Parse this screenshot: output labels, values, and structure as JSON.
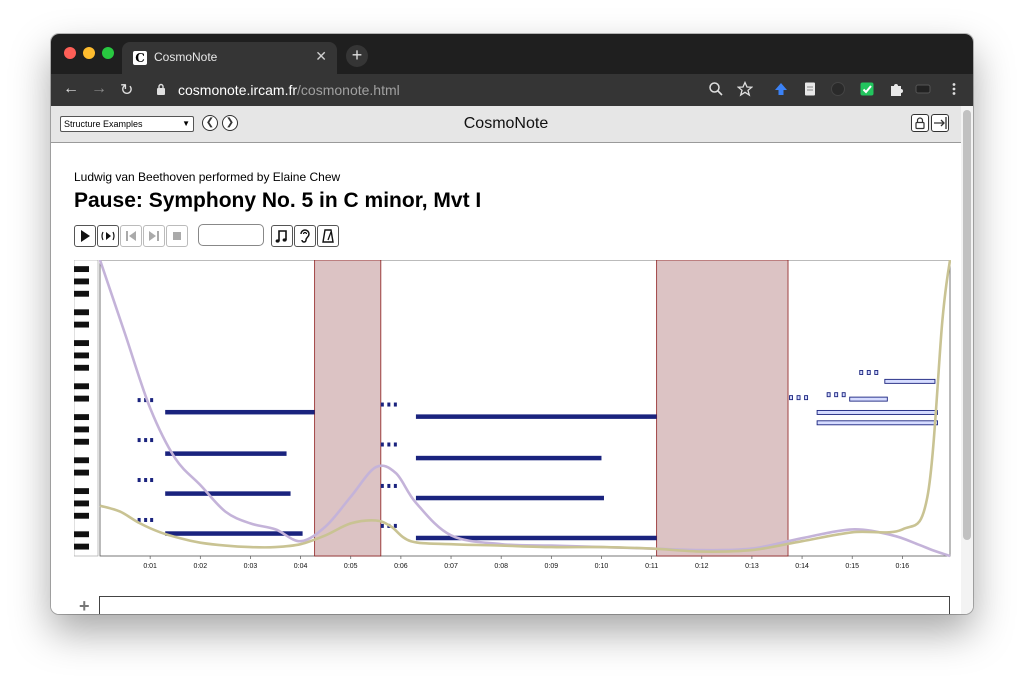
{
  "browser": {
    "tab_title": "CosmoNote",
    "tab_favicon_letter": "C",
    "url_host": "cosmonote.ircam.fr",
    "url_path": "/cosmonote.html"
  },
  "toolbar": {
    "select_value": "Structure Examples",
    "app_title": "CosmoNote"
  },
  "piece": {
    "subtitle": "Ludwig van Beethoven performed by Elaine Chew",
    "title": "Pause: Symphony No. 5 in C minor, Mvt I"
  },
  "colors": {
    "note_fill": "#1a237e",
    "pause_region": "#dcc3c4",
    "pause_border": "#8b1a1a",
    "curve_tempo": "#c4b3d9",
    "curve_loudness": "#c9c393",
    "hollow_note_fill": "#d6dcff"
  },
  "chart_data": {
    "type": "piano-roll",
    "x_unit": "seconds",
    "xlim": [
      0,
      16.95
    ],
    "x_ticks": [
      "0:01",
      "0:02",
      "0:03",
      "0:04",
      "0:05",
      "0:06",
      "0:07",
      "0:08",
      "0:09",
      "0:10",
      "0:11",
      "0:12",
      "0:13",
      "0:14",
      "0:15",
      "0:16"
    ],
    "pitch_range": [
      0,
      100
    ],
    "pauses": [
      {
        "start": 4.28,
        "end": 5.6
      },
      {
        "start": 11.1,
        "end": 13.72
      }
    ],
    "notes": [
      {
        "start": 0.75,
        "end": 0.8,
        "pitch": 52.5
      },
      {
        "start": 0.88,
        "end": 0.93,
        "pitch": 52.5
      },
      {
        "start": 1.0,
        "end": 1.05,
        "pitch": 52.5
      },
      {
        "start": 1.3,
        "end": 4.28,
        "pitch": 48.5,
        "long": true
      },
      {
        "start": 0.75,
        "end": 0.8,
        "pitch": 39
      },
      {
        "start": 0.88,
        "end": 0.93,
        "pitch": 39
      },
      {
        "start": 1.0,
        "end": 1.05,
        "pitch": 39
      },
      {
        "start": 1.3,
        "end": 3.72,
        "pitch": 34.5,
        "long": true
      },
      {
        "start": 0.75,
        "end": 0.8,
        "pitch": 25.5
      },
      {
        "start": 0.88,
        "end": 0.93,
        "pitch": 25.5
      },
      {
        "start": 1.0,
        "end": 1.05,
        "pitch": 25.5
      },
      {
        "start": 1.3,
        "end": 3.8,
        "pitch": 21,
        "long": true
      },
      {
        "start": 0.75,
        "end": 0.8,
        "pitch": 12
      },
      {
        "start": 0.88,
        "end": 0.93,
        "pitch": 12
      },
      {
        "start": 1.0,
        "end": 1.05,
        "pitch": 12
      },
      {
        "start": 1.3,
        "end": 4.04,
        "pitch": 7.5,
        "long": true
      },
      {
        "start": 5.6,
        "end": 5.65,
        "pitch": 51
      },
      {
        "start": 5.73,
        "end": 5.78,
        "pitch": 51
      },
      {
        "start": 5.86,
        "end": 5.91,
        "pitch": 51
      },
      {
        "start": 6.3,
        "end": 11.1,
        "pitch": 47,
        "long": true
      },
      {
        "start": 5.6,
        "end": 5.65,
        "pitch": 37.5
      },
      {
        "start": 5.73,
        "end": 5.78,
        "pitch": 37.5
      },
      {
        "start": 5.86,
        "end": 5.91,
        "pitch": 37.5
      },
      {
        "start": 6.3,
        "end": 10.0,
        "pitch": 33,
        "long": true
      },
      {
        "start": 5.6,
        "end": 5.65,
        "pitch": 23.5
      },
      {
        "start": 5.73,
        "end": 5.78,
        "pitch": 23.5
      },
      {
        "start": 5.86,
        "end": 5.91,
        "pitch": 23.5
      },
      {
        "start": 6.3,
        "end": 10.05,
        "pitch": 19.5,
        "long": true
      },
      {
        "start": 5.6,
        "end": 5.65,
        "pitch": 10
      },
      {
        "start": 5.73,
        "end": 5.78,
        "pitch": 10
      },
      {
        "start": 5.86,
        "end": 5.91,
        "pitch": 10
      },
      {
        "start": 6.3,
        "end": 11.1,
        "pitch": 6,
        "long": true
      },
      {
        "start": 13.75,
        "end": 13.8,
        "pitch": 53.5,
        "hollow": true
      },
      {
        "start": 13.9,
        "end": 13.95,
        "pitch": 53.5,
        "hollow": true
      },
      {
        "start": 14.05,
        "end": 14.1,
        "pitch": 53.5,
        "hollow": true
      },
      {
        "start": 14.5,
        "end": 14.55,
        "pitch": 54.5,
        "hollow": true
      },
      {
        "start": 14.65,
        "end": 14.7,
        "pitch": 54.5,
        "hollow": true
      },
      {
        "start": 14.8,
        "end": 14.85,
        "pitch": 54.5,
        "hollow": true
      },
      {
        "start": 14.95,
        "end": 15.7,
        "pitch": 53,
        "hollow": true
      },
      {
        "start": 15.15,
        "end": 15.2,
        "pitch": 62,
        "hollow": true
      },
      {
        "start": 15.3,
        "end": 15.35,
        "pitch": 62,
        "hollow": true
      },
      {
        "start": 15.45,
        "end": 15.5,
        "pitch": 62,
        "hollow": true
      },
      {
        "start": 15.65,
        "end": 16.65,
        "pitch": 59,
        "hollow": true
      },
      {
        "start": 14.3,
        "end": 16.7,
        "pitch": 48.5,
        "hollow": true
      },
      {
        "start": 14.3,
        "end": 16.7,
        "pitch": 45,
        "hollow": true
      }
    ],
    "series": [
      {
        "x": [
          0,
          0.5,
          1.0,
          1.5,
          2.0,
          2.5,
          3.0,
          3.5,
          4.0,
          4.5,
          5.0,
          5.5,
          5.9,
          6.3,
          7.0,
          8.0,
          9.0,
          10.0,
          11.0,
          12.0,
          13.0,
          14.0,
          15.0,
          15.8,
          16.3,
          16.6,
          16.95
        ],
        "y": [
          100,
          75,
          50,
          33,
          24,
          15,
          11,
          9,
          5,
          10,
          20,
          30,
          28,
          18,
          7,
          4,
          3.5,
          3,
          2.5,
          2,
          2.5,
          6,
          9,
          7,
          4,
          2,
          0
        ]
      },
      {
        "x": [
          0,
          0.4,
          0.8,
          1.2,
          1.6,
          2.0,
          2.5,
          3.0,
          3.5,
          4.0,
          4.5,
          5.0,
          5.5,
          5.8,
          6.2,
          7.0,
          8.0,
          9.0,
          10.0,
          11.0,
          12.0,
          13.0,
          14.0,
          15.0,
          16.0,
          16.5,
          16.8,
          16.95
        ],
        "y": [
          17,
          15,
          11,
          8,
          6,
          4.5,
          3.5,
          3,
          3,
          4,
          7,
          11,
          12,
          10,
          5,
          4,
          3.5,
          3,
          3,
          2.5,
          1.5,
          2,
          5,
          8,
          9,
          20,
          80,
          100
        ]
      }
    ]
  }
}
